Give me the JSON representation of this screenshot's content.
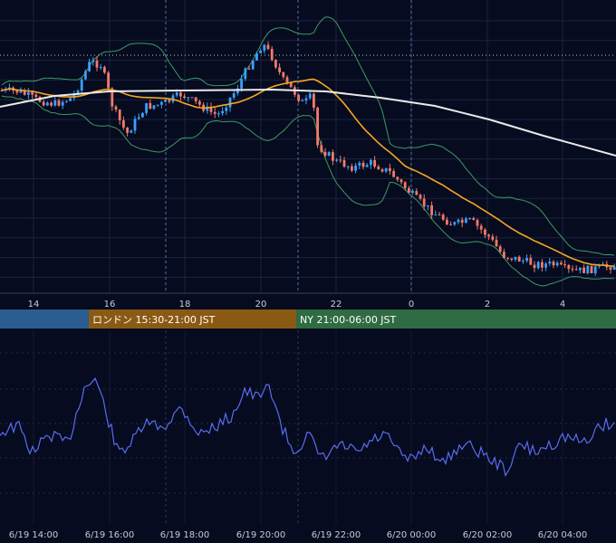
{
  "chart_data": [
    {
      "type": "candlestick",
      "indicators": [
        "bollinger-bands",
        "moving-average-short",
        "moving-average-long"
      ],
      "x_ticks_upper": [
        "14",
        "16",
        "18",
        "20",
        "22",
        "0",
        "2",
        "4"
      ],
      "grid": true,
      "reference_line": "dotted-horizontal",
      "colors": {
        "background": "#060b1f",
        "grid": "#1c2340",
        "bull": "#3aa0ff",
        "bear": "#f07a6a",
        "bollinger": "#3e9a62",
        "ma_short": "#f5a623",
        "ma_long": "#eaeaea"
      },
      "sessions": [
        {
          "name": "",
          "color": "#2b5d93"
        },
        {
          "name": "ロンドン 15:30-21:00 JST",
          "color": "#8a5a14"
        },
        {
          "name": "NY 21:00-06:00 JST",
          "color": "#2f6b43"
        }
      ]
    },
    {
      "type": "line",
      "series_color": "#5a6cf0",
      "x_ticks_lower": [
        "6/19 14:00",
        "6/19 16:00",
        "6/19 18:00",
        "6/19 20:00",
        "6/19 22:00",
        "6/20 00:00",
        "6/20 02:00",
        "6/20 04:00"
      ],
      "grid": true
    }
  ]
}
